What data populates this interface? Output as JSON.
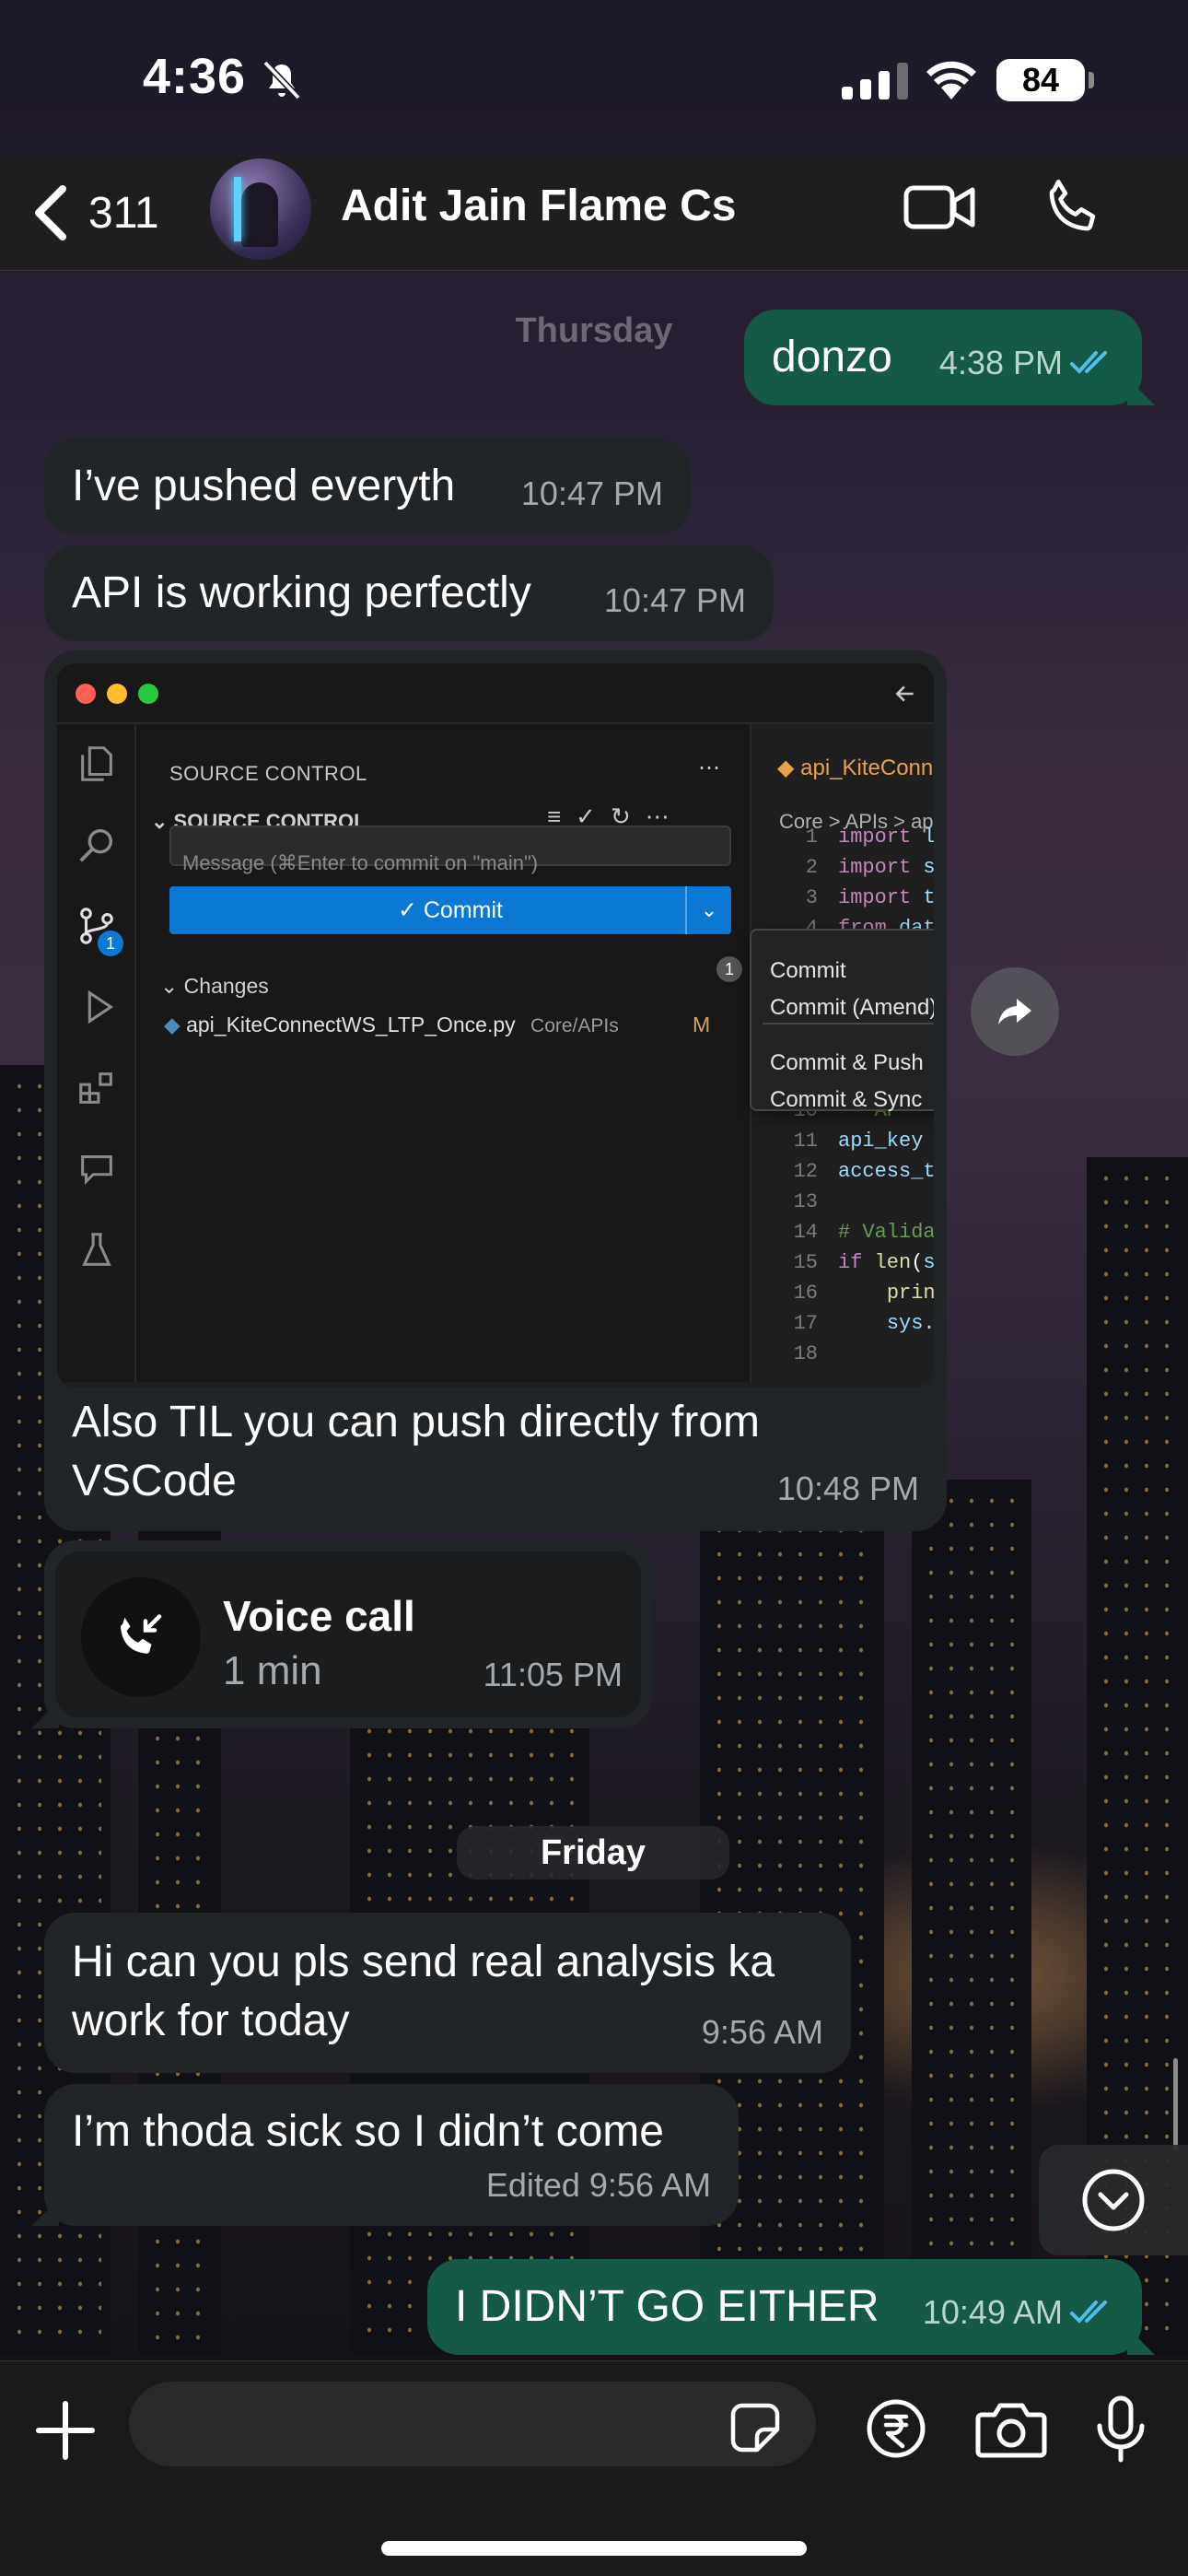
{
  "status": {
    "time": "4:36",
    "battery": "84"
  },
  "header": {
    "back_count": "311",
    "contact_name": "Adit Jain Flame Cs"
  },
  "messages": {
    "day_thursday": "Thursday",
    "m1": {
      "text": "donzo",
      "time": "4:38 PM"
    },
    "m2": {
      "text": "I’ve pushed everyth",
      "time": "10:47 PM"
    },
    "m3": {
      "text": "API is working perfectly",
      "time": "10:47 PM"
    },
    "m4": {
      "caption": "Also TIL you can push directly from VSCode",
      "time": "10:48 PM",
      "screenshot": {
        "panel_title": "SOURCE CONTROL",
        "section_title": "SOURCE CONTROL",
        "message_placeholder": "Message (⌘Enter to commit on \"main\")",
        "commit_label": "✓ Commit",
        "changes_label": "Changes",
        "changes_count": "1",
        "file_name": "api_KiteConnectWS_LTP_Once.py",
        "file_path": "Core/APIs",
        "file_status": "M",
        "badge": "1",
        "menu": [
          "Commit",
          "Commit (Amend)",
          "Commit & Push",
          "Commit & Sync"
        ],
        "tab_name": "api_KiteConnectW",
        "breadcrumb": "Core > APIs > ap"
      }
    },
    "m5": {
      "title": "Voice call",
      "duration": "1 min",
      "time": "11:05 PM"
    },
    "day_friday": "Friday",
    "m6": {
      "text": "Hi can you pls send real analysis ka work for today",
      "time": "9:56 AM"
    },
    "m7": {
      "text": "I’m thoda sick so I didn’t come",
      "time": "Edited 9:56 AM"
    },
    "m8": {
      "text": "I DIDN’T GO EITHER",
      "time": "10:49 AM"
    }
  },
  "icons": {
    "status": [
      "bell-slash-icon",
      "signal-icon",
      "wifi-icon",
      "battery-icon"
    ],
    "header": [
      "chevron-left-icon",
      "video-camera-icon",
      "phone-icon"
    ],
    "composer": [
      "plus-icon",
      "sticker-icon",
      "rupee-icon",
      "camera-icon",
      "microphone-icon"
    ]
  },
  "colors": {
    "outgoing_bubble": "#155947",
    "incoming_bubble": "#222527",
    "read_ticks": "#53bdeb",
    "vscode_accent": "#0b78d4"
  }
}
